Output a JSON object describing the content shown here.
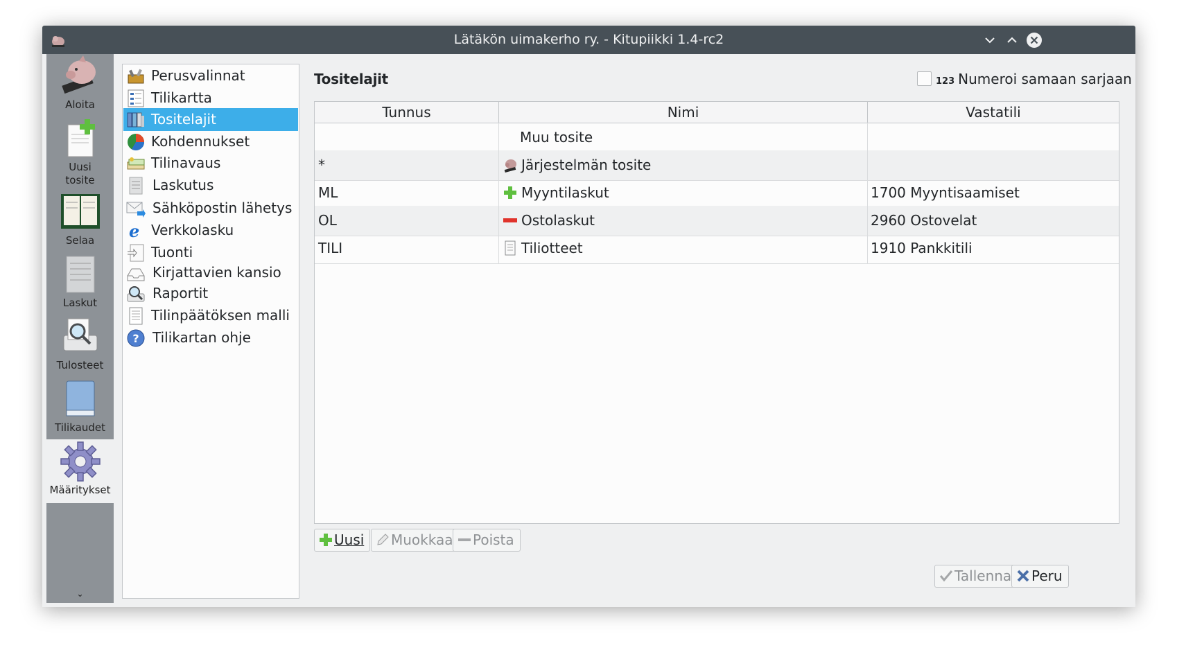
{
  "window": {
    "title": "Lätäkön uimakerho ry. - Kitupiikki 1.4-rc2"
  },
  "sidebar": {
    "items": [
      {
        "label": "Aloita",
        "icon": "piggy-bank-icon"
      },
      {
        "label": "Uusi\ntosite",
        "icon": "new-document-icon"
      },
      {
        "label": "Selaa",
        "icon": "ledger-book-icon"
      },
      {
        "label": "Laskut",
        "icon": "invoice-icon"
      },
      {
        "label": "Tulosteet",
        "icon": "print-preview-icon"
      },
      {
        "label": "Tilikaudet",
        "icon": "book-icon"
      },
      {
        "label": "Määritykset",
        "icon": "gear-icon"
      }
    ],
    "more": "⌄"
  },
  "settings_nav": {
    "items": [
      {
        "label": "Perusvalinnat",
        "icon": "toolbox-icon"
      },
      {
        "label": "Tilikartta",
        "icon": "account-chart-icon"
      },
      {
        "label": "Tositelajit",
        "icon": "binders-icon"
      },
      {
        "label": "Kohdennukset",
        "icon": "pie-chart-icon"
      },
      {
        "label": "Tilinavaus",
        "icon": "money-icon"
      },
      {
        "label": "Laskutus",
        "icon": "invoice-icon"
      },
      {
        "label": "Sähköpostin lähetys",
        "icon": "mail-send-icon"
      },
      {
        "label": "Verkkolasku",
        "icon": "e-invoice-icon"
      },
      {
        "label": "Tuonti",
        "icon": "import-icon"
      },
      {
        "label": "Kirjattavien kansio",
        "icon": "inbox-icon"
      },
      {
        "label": "Raportit",
        "icon": "report-icon"
      },
      {
        "label": "Tilinpäätöksen malli",
        "icon": "document-icon"
      },
      {
        "label": "Tilikartan ohje",
        "icon": "help-icon"
      }
    ],
    "active_index": 2
  },
  "main": {
    "heading": "Tositelajit",
    "numeroi": {
      "label": "Numeroi samaan sarjaan",
      "badge": "123",
      "checked": false
    },
    "table": {
      "columns": [
        "Tunnus",
        "Nimi",
        "Vastatili"
      ],
      "rows": [
        {
          "tunnus": "",
          "nimi": "Muu tosite",
          "icon": "",
          "vastatili": ""
        },
        {
          "tunnus": "*",
          "nimi": "Järjestelmän tosite",
          "icon": "piggy-icon",
          "vastatili": ""
        },
        {
          "tunnus": "ML",
          "nimi": "Myyntilaskut",
          "icon": "plus-icon",
          "vastatili": "1700 Myyntisaamiset"
        },
        {
          "tunnus": "OL",
          "nimi": "Ostolaskut",
          "icon": "minus-icon",
          "vastatili": "2960 Ostovelat"
        },
        {
          "tunnus": "TILI",
          "nimi": "Tiliotteet",
          "icon": "statement-icon",
          "vastatili": "1910 Pankkitili"
        }
      ]
    },
    "buttons": {
      "new": "Uusi",
      "edit": "Muokkaa",
      "delete": "Poista",
      "save": "Tallenna",
      "cancel": "Peru"
    }
  },
  "colors": {
    "accent": "#3daee9",
    "titlebar": "#475057",
    "sidebar": "#8d9297"
  }
}
